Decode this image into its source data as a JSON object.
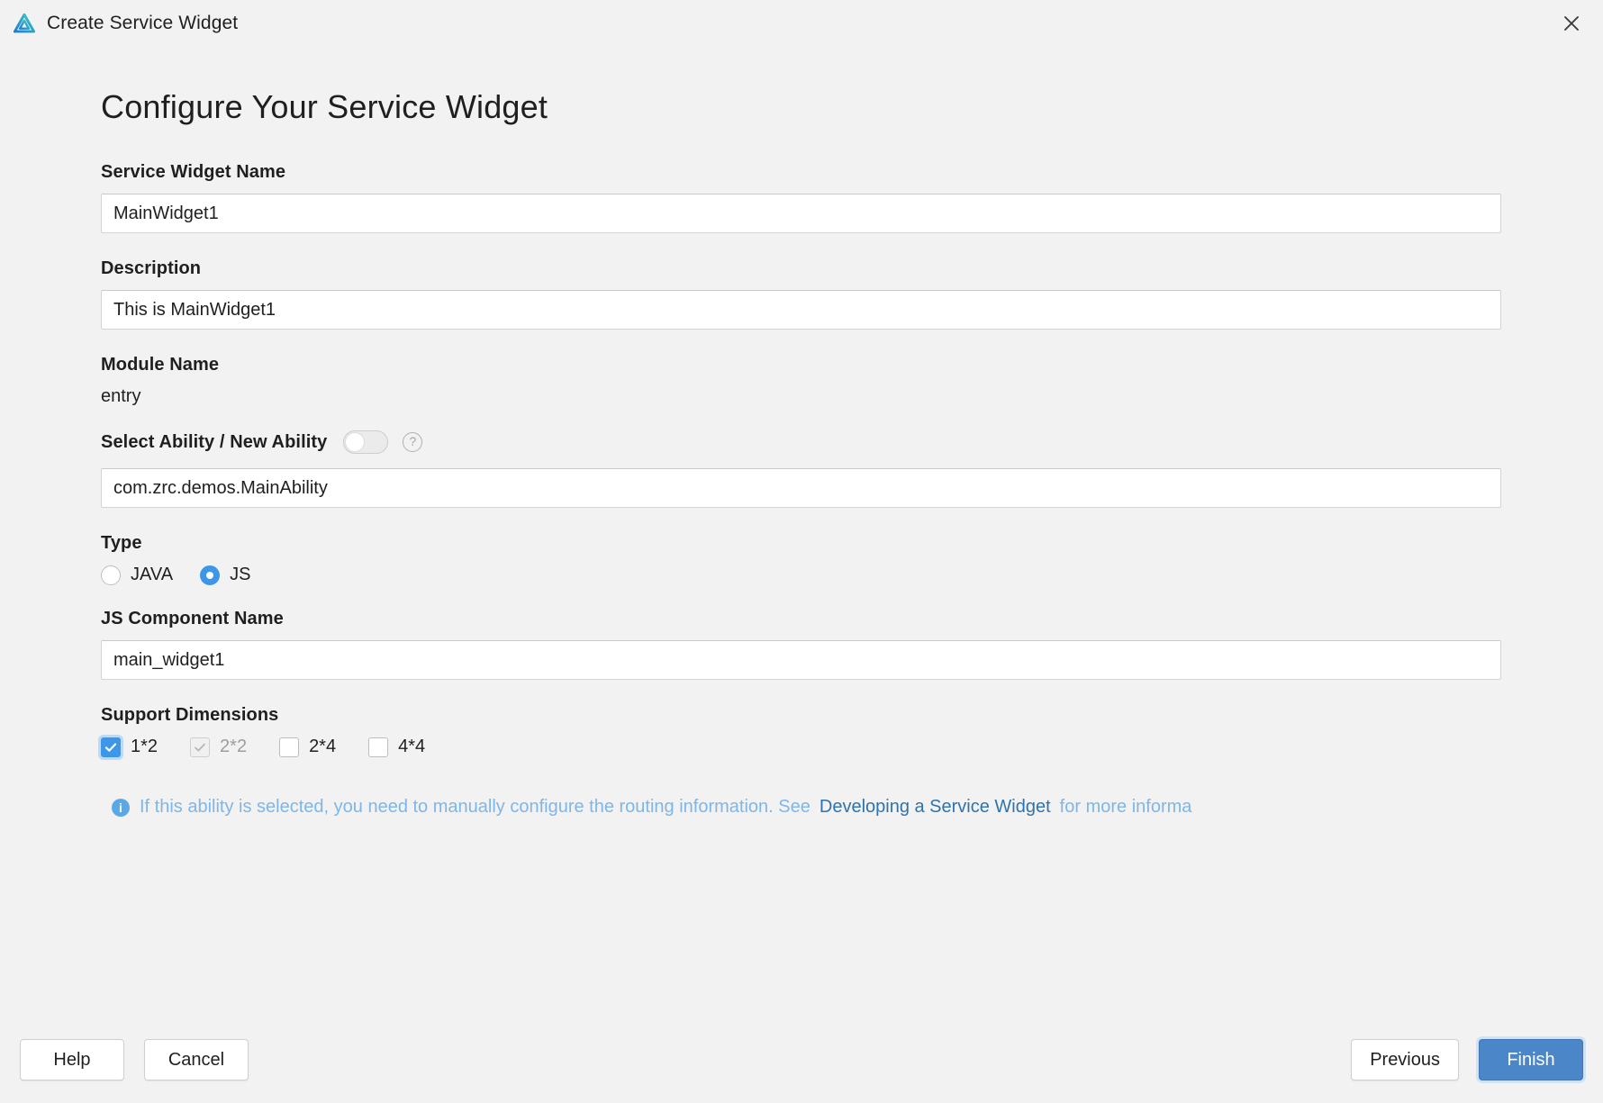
{
  "window": {
    "title": "Create Service Widget",
    "logo_icon": "deveco-logo-icon",
    "close_icon": "close-icon"
  },
  "page": {
    "heading": "Configure Your Service Widget"
  },
  "fields": {
    "widget_name": {
      "label": "Service Widget Name",
      "value": "MainWidget1",
      "placeholder": "Service Widget Name"
    },
    "description": {
      "label": "Description",
      "value": "This is MainWidget1",
      "placeholder": "Description"
    },
    "module_name": {
      "label": "Module Name",
      "value": "entry"
    },
    "select_ability": {
      "label": "Select Ability / New Ability",
      "toggle_state": "off",
      "help_icon": "question-mark-icon",
      "value": "com.zrc.demos.MainAbility",
      "placeholder": "Ability name"
    },
    "type": {
      "label": "Type",
      "options": [
        {
          "label": "JAVA",
          "selected": false
        },
        {
          "label": "JS",
          "selected": true
        }
      ]
    },
    "js_component_name": {
      "label": "JS Component Name",
      "value": "main_widget1",
      "placeholder": "JS Component Name"
    },
    "support_dimensions": {
      "label": "Support Dimensions",
      "options": [
        {
          "label": "1*2",
          "checked": true,
          "disabled": false
        },
        {
          "label": "2*2",
          "checked": true,
          "disabled": true
        },
        {
          "label": "2*4",
          "checked": false,
          "disabled": false
        },
        {
          "label": "4*4",
          "checked": false,
          "disabled": false
        }
      ]
    }
  },
  "info_note": {
    "icon": "info-icon",
    "text_before": "If this ability is selected, you need to manually configure the routing information. See",
    "link_text": "Developing a Service Widget",
    "text_after": "for more informa"
  },
  "footer": {
    "help_label": "Help",
    "cancel_label": "Cancel",
    "previous_label": "Previous",
    "finish_label": "Finish"
  },
  "colors": {
    "background": "#f2f2f2",
    "accent_blue": "#3d96e8",
    "primary_button": "#4a86c8",
    "info_text": "#7fb6e8",
    "link": "#2f73ad"
  }
}
